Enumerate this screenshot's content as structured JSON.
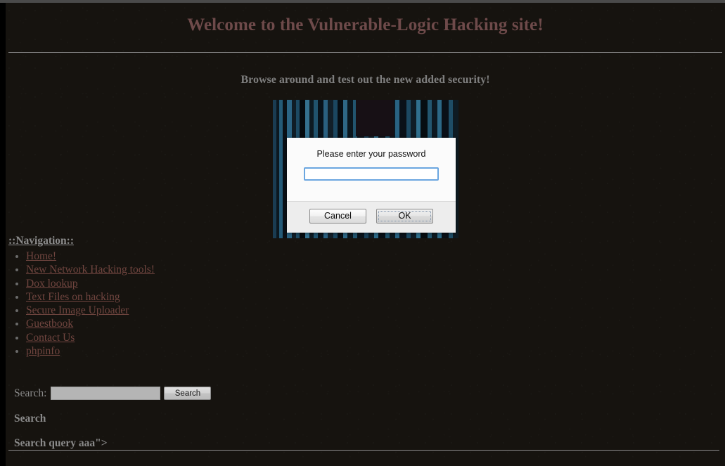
{
  "page": {
    "title": "Welcome to the Vulnerable-Logic Hacking site!",
    "subtitle": "Browse around and test out the new added security!"
  },
  "colors": {
    "page_background": "#16130f",
    "title": "#6e4a4a",
    "subtitle": "#7e7e7e",
    "link": "#70453f",
    "muted_text": "#8a8a8a",
    "rule": "#8d8d8d",
    "dialog_focus_border": "#6ba6e0"
  },
  "dialog": {
    "message": "Please enter your password",
    "password_value": "",
    "password_placeholder": "",
    "cancel_label": "Cancel",
    "ok_label": "OK",
    "focused_button": "OK"
  },
  "navigation": {
    "heading": "::Navigation::",
    "items": [
      {
        "label": "Home!"
      },
      {
        "label": "New Network Hacking tools!"
      },
      {
        "label": "Dox lookup"
      },
      {
        "label": "Text Files on hacking"
      },
      {
        "label": "Secure Image Uploader"
      },
      {
        "label": "Guestbook"
      },
      {
        "label": "Contact Us"
      },
      {
        "label": "phpinfo"
      }
    ]
  },
  "search": {
    "label": "Search:",
    "input_value": "",
    "input_placeholder": "",
    "submit_label": "Search",
    "results_heading": "Search",
    "query_line": "Search query aaa\">"
  }
}
